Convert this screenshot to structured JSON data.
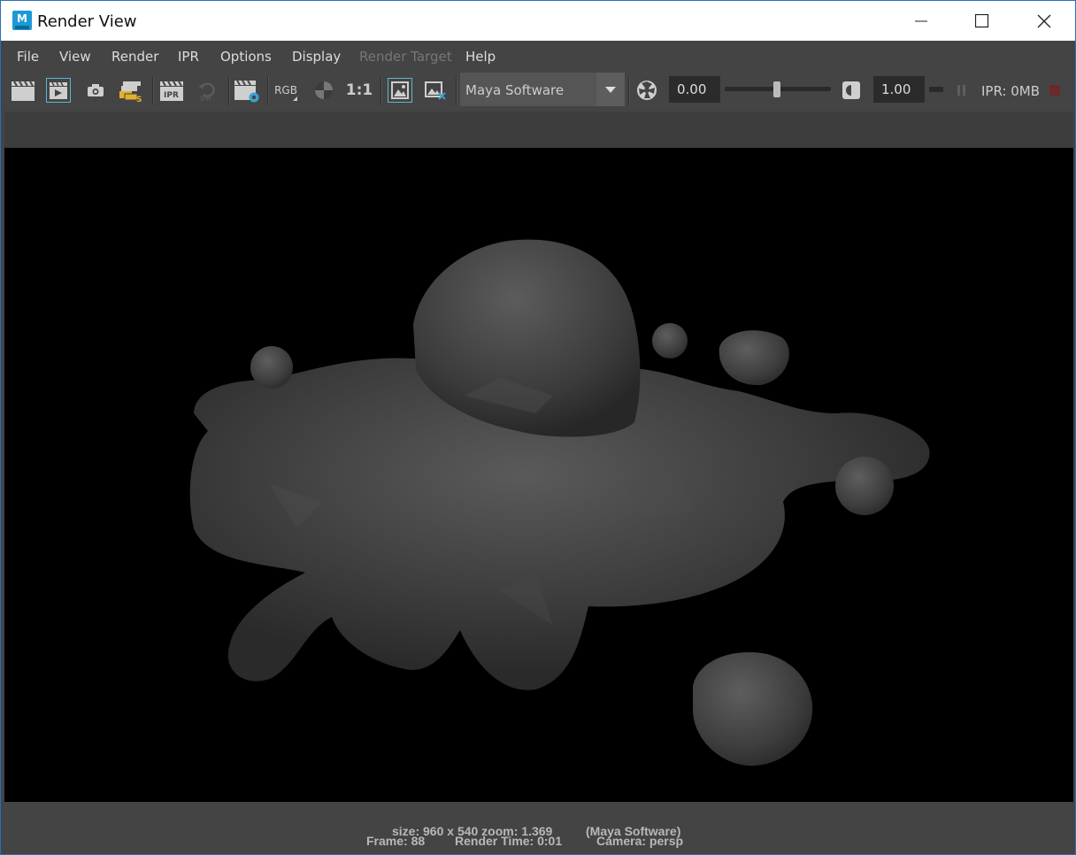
{
  "window": {
    "title": "Render View",
    "app_icon_letter": "M"
  },
  "menu": [
    {
      "label": "File",
      "enabled": true
    },
    {
      "label": "View",
      "enabled": true
    },
    {
      "label": "Render",
      "enabled": true
    },
    {
      "label": "IPR",
      "enabled": true
    },
    {
      "label": "Options",
      "enabled": true
    },
    {
      "label": "Display",
      "enabled": true
    },
    {
      "label": "Render Target",
      "enabled": false
    },
    {
      "label": "Help",
      "enabled": true
    }
  ],
  "toolbar": {
    "rgb_label": "RGB",
    "ratio_label": "1:1",
    "ipr_icon_label": "IPR",
    "renderer_value": "Maya Software",
    "exposure_value": "0.00",
    "gamma_value": "1.00",
    "gamma_slider_level": 0.5,
    "ipr_memory": "IPR: 0MB"
  },
  "status": {
    "line1_left": "size: 960 x 540 zoom: 1.369",
    "line1_right": "(Maya Software)",
    "frame": "Frame: 88",
    "render_time": "Render Time: 0:01",
    "camera": "Camera: persp"
  },
  "colors": {
    "accent": "#5bb6d6",
    "viewport_bg": "#000000",
    "panel_bg": "#444444"
  }
}
